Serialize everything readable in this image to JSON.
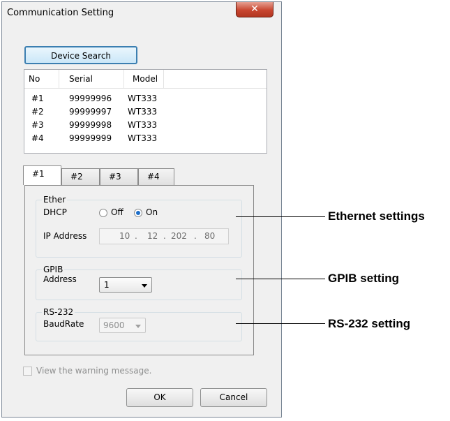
{
  "window": {
    "title": "Communication Setting",
    "close_glyph": "✕"
  },
  "search_button": "Device Search",
  "device_list": {
    "columns": [
      "No",
      "Serial",
      "Model"
    ],
    "rows": [
      {
        "no": "#1",
        "serial": "99999996",
        "model": "WT333"
      },
      {
        "no": "#2",
        "serial": "99999997",
        "model": "WT333"
      },
      {
        "no": "#3",
        "serial": "99999998",
        "model": "WT333"
      },
      {
        "no": "#4",
        "serial": "99999999",
        "model": "WT333"
      }
    ]
  },
  "tabs": [
    {
      "label": "#1",
      "active": true
    },
    {
      "label": "#2"
    },
    {
      "label": "#3"
    },
    {
      "label": "#4"
    }
  ],
  "ether": {
    "group_label": "Ether",
    "dhcp_label": "DHCP",
    "off_label": "Off",
    "on_label": "On",
    "dhcp_value": "On",
    "ip_label": "IP Address",
    "ip": [
      "10",
      "12",
      "202",
      "80"
    ]
  },
  "gpib": {
    "group_label": "GPIB",
    "address_label": "Address",
    "address_value": "1"
  },
  "rs232": {
    "group_label": "RS-232",
    "baud_label": "BaudRate",
    "baud_value": "9600"
  },
  "warning_checkbox": {
    "label": "View the warning message.",
    "checked": false
  },
  "ok_button": "OK",
  "cancel_button": "Cancel",
  "annotations": {
    "ethernet": "Ethernet settings",
    "gpib": "GPIB setting",
    "rs232": "RS-232 setting"
  }
}
